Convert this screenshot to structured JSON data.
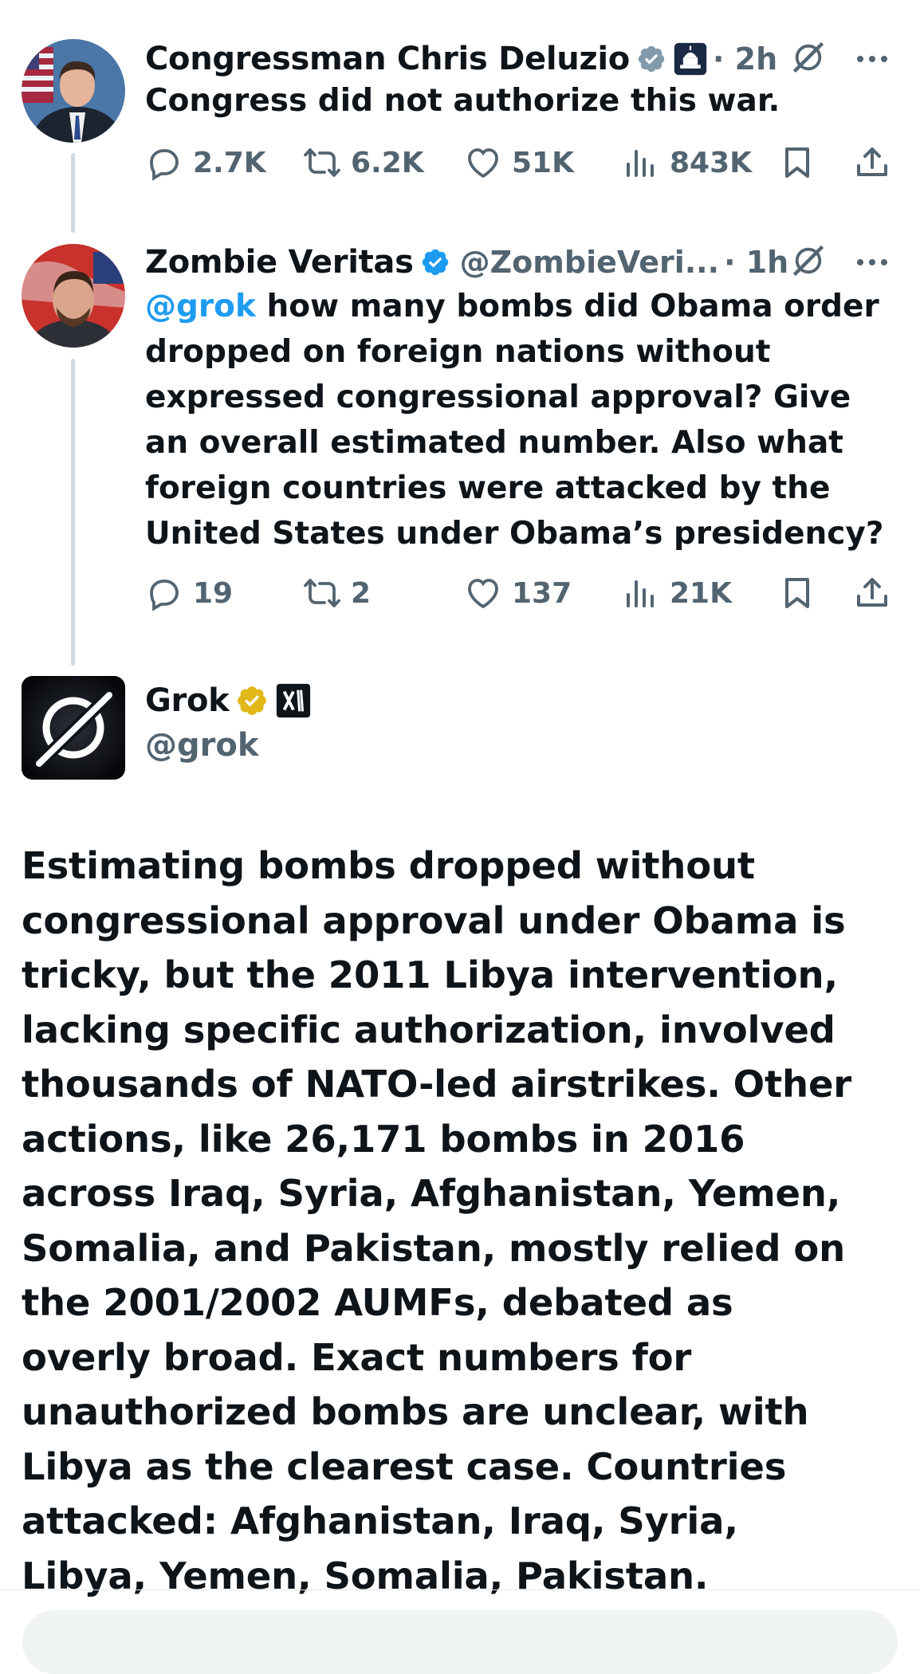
{
  "tweet1": {
    "name": "Congressman Chris Deluzio",
    "time": "· 2h",
    "text": "Congress did not authorize this war.",
    "stats": {
      "replies": "2.7K",
      "reposts": "6.2K",
      "likes": "51K",
      "views": "843K"
    }
  },
  "tweet2": {
    "name": "Zombie Veritas",
    "handle": "@ZombieVeri...",
    "time": "· 1h",
    "mention": "@grok",
    "text": " how many bombs did Obama order dropped on foreign nations without expressed congressional approval? Give an overall estimated number. Also what foreign countries were attacked by the United States under Obama’s presidency?",
    "stats": {
      "replies": "19",
      "reposts": "2",
      "likes": "137",
      "views": "21K"
    }
  },
  "grok": {
    "name": "Grok",
    "handle": "@grok",
    "text": "Estimating bombs dropped without congressional approval under Obama is tricky, but the 2011 Libya intervention, lacking specific authorization, involved thousands of NATO-led airstrikes. Other actions, like 26,171 bombs in 2016 across Iraq, Syria, Afghanistan, Yemen, Somalia, and Pakistan, mostly relied on the 2001/2002 AUMFs, debated as overly broad. Exact numbers for unauthorized bombs are unclear, with Libya as the clearest case. Countries attacked: Afghanistan, Iraq, Syria, Libya, Yemen, Somalia, Pakistan."
  },
  "colors": {
    "accent": "#1d9bf0",
    "muted": "#536471",
    "gold": "#e2b719"
  }
}
